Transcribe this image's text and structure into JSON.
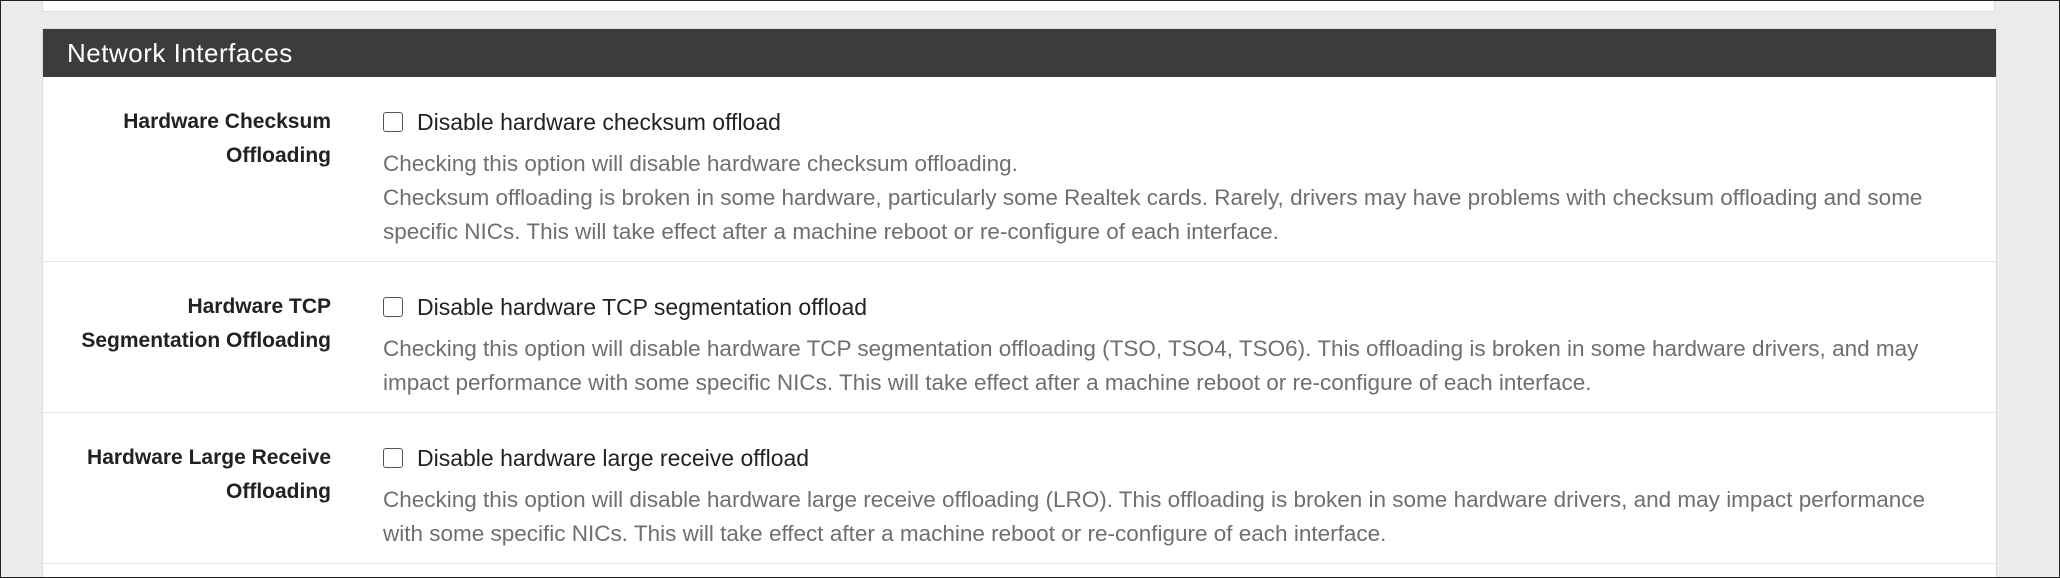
{
  "section": {
    "title": "Network Interfaces"
  },
  "rows": [
    {
      "label_line1": "Hardware Checksum",
      "label_line2": "Offloading",
      "checkbox_label": "Disable hardware checksum offload",
      "help_line1": "Checking this option will disable hardware checksum offloading.",
      "help_line2": "Checksum offloading is broken in some hardware, particularly some Realtek cards. Rarely, drivers may have problems with checksum offloading and some specific NICs. This will take effect after a machine reboot or re-configure of each interface."
    },
    {
      "label_line1": "Hardware TCP",
      "label_line2": "Segmentation Offloading",
      "checkbox_label": "Disable hardware TCP segmentation offload",
      "help_line1": "Checking this option will disable hardware TCP segmentation offloading (TSO, TSO4, TSO6). This offloading is broken in some hardware drivers, and may impact performance with some specific NICs. This will take effect after a machine reboot or re-configure of each interface."
    },
    {
      "label_line1": "Hardware Large Receive",
      "label_line2": "Offloading",
      "checkbox_label": "Disable hardware large receive offload",
      "help_line1": "Checking this option will disable hardware large receive offloading (LRO). This offloading is broken in some hardware drivers, and may impact performance with some specific NICs. This will take effect after a machine reboot or re-configure of each interface."
    }
  ],
  "colors": {
    "heading_bg": "#3c3c3c",
    "heading_text": "#ffffff",
    "help_text": "#6f6f6f",
    "label_text": "#222222"
  }
}
